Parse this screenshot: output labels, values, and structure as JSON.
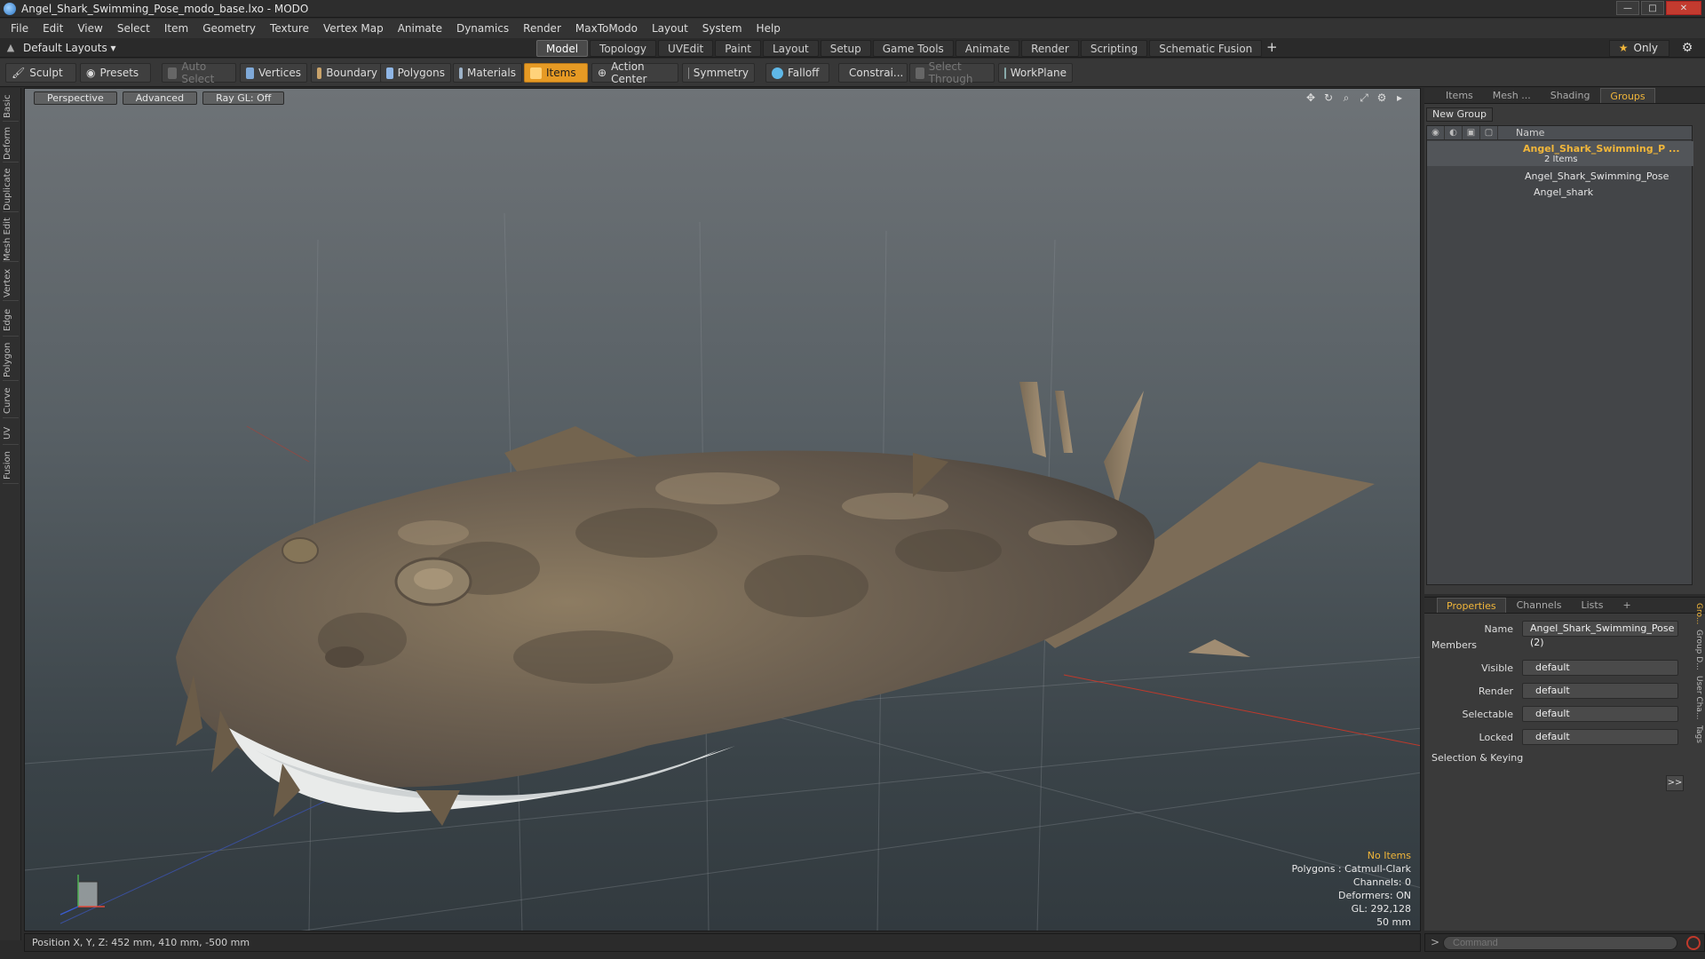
{
  "window": {
    "title": "Angel_Shark_Swimming_Pose_modo_base.lxo - MODO",
    "minimize": "—",
    "maximize": "□",
    "close": "✕"
  },
  "menu": [
    "File",
    "Edit",
    "View",
    "Select",
    "Item",
    "Geometry",
    "Texture",
    "Vertex Map",
    "Animate",
    "Dynamics",
    "Render",
    "MaxToModo",
    "Layout",
    "System",
    "Help"
  ],
  "layout_tabs": {
    "layout_selector": "Default Layouts ▾",
    "tabs": [
      "Model",
      "Topology",
      "UVEdit",
      "Paint",
      "Layout",
      "Setup",
      "Game Tools",
      "Animate",
      "Render",
      "Scripting",
      "Schematic Fusion"
    ],
    "active": "Model",
    "add": "+",
    "only": "Only"
  },
  "toolbar": {
    "sculpt": "Sculpt",
    "presets": "Presets",
    "auto_select": "Auto Select",
    "vertices": "Vertices",
    "boundary": "Boundary",
    "polygons": "Polygons",
    "materials": "Materials",
    "items": "Items",
    "action_center": "Action Center",
    "symmetry": "Symmetry",
    "falloff": "Falloff",
    "constrain": "Constrai...",
    "select_through": "Select Through",
    "workplane": "WorkPlane"
  },
  "left_tabs": [
    "Basic",
    "Deform",
    "Duplicate",
    "Mesh Edit",
    "Vertex",
    "Edge",
    "Polygon",
    "Curve",
    "UV",
    "Fusion"
  ],
  "viewport": {
    "view_mode": "Perspective",
    "shading": "Advanced",
    "raygl": "Ray GL: Off",
    "stats": {
      "selection": "No Items",
      "polygons": "Polygons : Catmull-Clark",
      "channels": "Channels: 0",
      "deformers": "Deformers: ON",
      "gl": "GL: 292,128",
      "scale": "50 mm"
    }
  },
  "status": {
    "position": "Position X, Y, Z:  452 mm, 410 mm, -500 mm"
  },
  "groups_panel": {
    "tabs": [
      "Items",
      "Mesh ...",
      "Shading",
      "Groups"
    ],
    "active_tab": "Groups",
    "new_group": "New Group",
    "column_name": "Name",
    "group_name": "Angel_Shark_Swimming_P ...",
    "group_count": "2 Items",
    "members": [
      "Angel_Shark_Swimming_Pose",
      "Angel_shark"
    ]
  },
  "properties": {
    "tabs": [
      "Properties",
      "Channels",
      "Lists"
    ],
    "add": "+",
    "name_label": "Name",
    "name_value": "Angel_Shark_Swimming_Pose (2)",
    "members_section": "Members",
    "fields": [
      {
        "label": "Visible",
        "value": "default"
      },
      {
        "label": "Render",
        "value": "default"
      },
      {
        "label": "Selectable",
        "value": "default"
      },
      {
        "label": "Locked",
        "value": "default"
      }
    ],
    "keying_section": "Selection & Keying",
    "more": ">>",
    "side_tabs": [
      "Gro...",
      "Group D...",
      "User Cha...",
      "Tags"
    ]
  },
  "command": {
    "prompt": ">",
    "placeholder": "Command"
  },
  "colors": {
    "accent": "#f1b63a",
    "active_tool": "#e69a24"
  }
}
